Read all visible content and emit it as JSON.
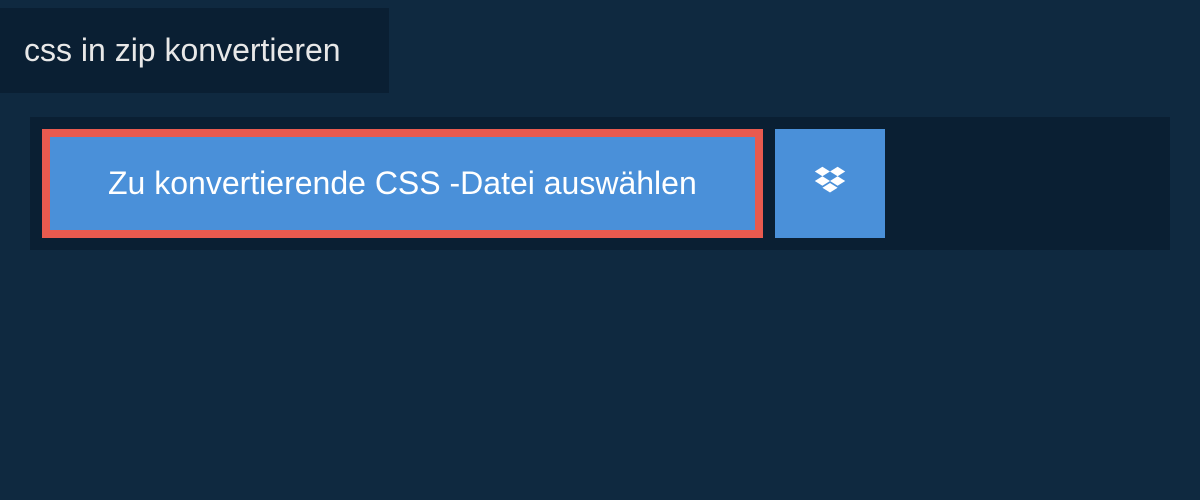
{
  "tab": {
    "title": "css in zip konvertieren"
  },
  "panel": {
    "select_button_label": "Zu konvertierende CSS -Datei auswählen"
  }
}
